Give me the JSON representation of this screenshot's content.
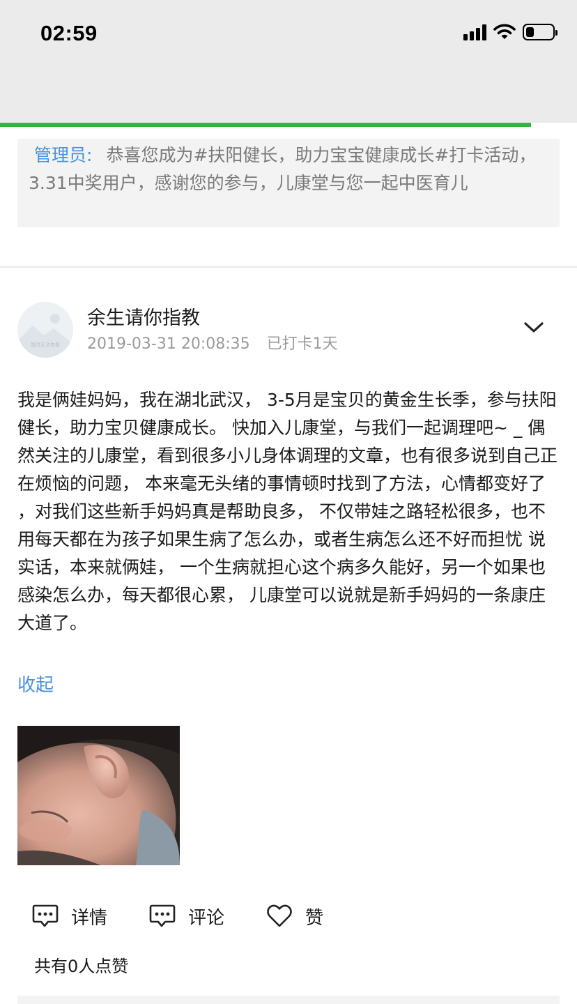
{
  "status_bar": {
    "time": "02:59",
    "icons": [
      "signal-icon",
      "wifi-icon",
      "battery-icon"
    ],
    "battery_level": 0.3
  },
  "page_progress": 0.92,
  "colors": {
    "accent_blue": "#4a90d9",
    "progress_green": "#33b344",
    "meta_gray": "#9a9a9a",
    "notice_bg": "#f3f3f3"
  },
  "admin_notice": {
    "label": "管理员:",
    "text": "恭喜您成为#扶阳健长，助力宝宝健康成长#打卡活动，3.31中奖用户，感谢您的参与，儿康堂与您一起中医育儿"
  },
  "post": {
    "avatar_caption": "暂时无法查看",
    "username": "余生请你指教",
    "datetime": "2019-03-31 20:08:35",
    "checkin": "已打卡1天",
    "body": "我是俩娃妈妈，我在湖北武汉， 3-5月是宝贝的黄金生长季，参与扶阳健长，助力宝贝健康成长。 快加入儿康堂，与我们一起调理吧~ _ 偶然关注的儿康堂，看到很多小儿身体调理的文章，也有很多说到自己正在烦恼的问题， 本来毫无头绪的事情顿时找到了方法，心情都变好了 ，对我们这些新手妈妈真是帮助良多， 不仅带娃之路轻松很多，也不用每天都在为孩子如果生病了怎么办，或者生病怎么还不好而担忧 说实话，本来就俩娃， 一个生病就担心这个病多久能好，另一个如果也感染怎么办，每天都很心累， 儿康堂可以说就是新手妈妈的一条康庄大道了。",
    "collapse_label": "收起"
  },
  "actions": {
    "details_label": "详情",
    "comment_label": "评论",
    "like_label": "赞",
    "likes_summary": "共有0人点赞"
  }
}
